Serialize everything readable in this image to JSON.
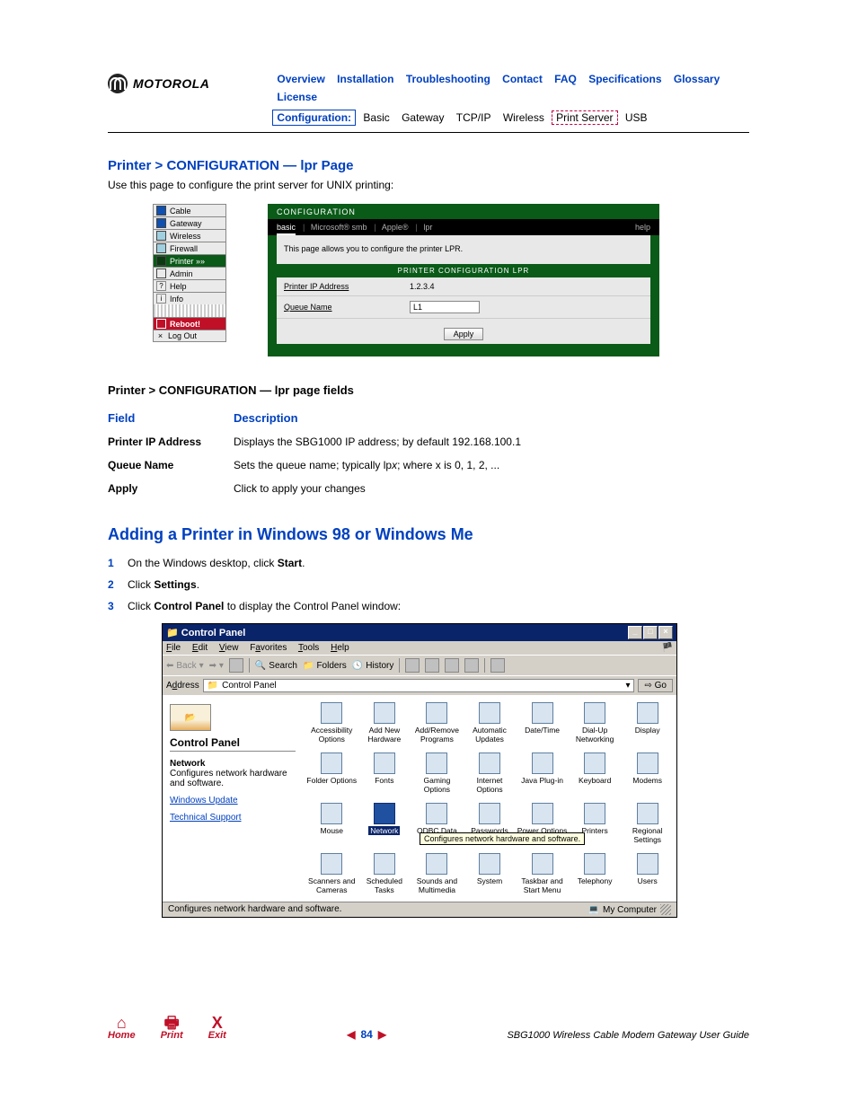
{
  "logo_text": "MOTOROLA",
  "nav": {
    "row1": [
      "Overview",
      "Installation",
      "Troubleshooting",
      "Contact",
      "FAQ",
      "Specifications",
      "Glossary",
      "License"
    ],
    "current": "Configuration:",
    "row2": [
      "Basic",
      "Gateway",
      "TCP/IP",
      "Wireless"
    ],
    "print_server": "Print Server",
    "row2_after": "USB"
  },
  "section_title": "Printer > CONFIGURATION — lpr Page",
  "intro": "Use this page to configure the print server for UNIX printing:",
  "sidebar_items": [
    {
      "label": "Cable",
      "sq": "sb-blue"
    },
    {
      "label": "Gateway",
      "sq": "sb-blue"
    },
    {
      "label": "Wireless",
      "sq": "sb-cyan"
    },
    {
      "label": "Firewall",
      "sq": "sb-cyan"
    },
    {
      "label": "Printer   »»",
      "sq": "",
      "cls": "sb-printer"
    },
    {
      "label": "Admin",
      "sq": ""
    },
    {
      "label": "Help",
      "sq": "",
      "pre": "?"
    },
    {
      "label": "Info",
      "sq": "",
      "pre": "i"
    }
  ],
  "sb_reboot": "Reboot!",
  "sb_logout": "Log Out",
  "cp": {
    "title": "CONFIGURATION",
    "tabs": [
      "basic",
      "Microsoft® smb",
      "Apple®",
      "lpr"
    ],
    "help": "help",
    "hint": "This page allows you to configure the printer LPR.",
    "barhead": "PRINTER CONFIGURATION LPR",
    "row1_label": "Printer IP Address",
    "row1_value": "1.2.3.4",
    "row2_label": "Queue Name",
    "row2_value": "L1",
    "apply": "Apply"
  },
  "fields_title": "Printer > CONFIGURATION — lpr page fields",
  "fields_head_field": "Field",
  "fields_head_desc": "Description",
  "fields": [
    {
      "f": "Printer IP Address",
      "d": "Displays the SBG1000 IP address; by default 192.168.100.1"
    },
    {
      "f": "Queue Name",
      "d": "Sets the queue name; typically lpx; where x is 0, 1, 2, ..."
    },
    {
      "f": "Apply",
      "d": "Click to apply your changes"
    }
  ],
  "h2": "Adding a Printer in Windows 98 or Windows Me",
  "steps": [
    {
      "n": "1",
      "pre": "On the Windows desktop, click ",
      "bold": "Start",
      "post": "."
    },
    {
      "n": "2",
      "pre": "Click ",
      "bold": "Settings",
      "post": "."
    },
    {
      "n": "3",
      "pre": "Click ",
      "bold": "Control Panel",
      "post": " to display the Control Panel window:"
    }
  ],
  "cpw": {
    "title": "Control Panel",
    "menu": [
      "File",
      "Edit",
      "View",
      "Favorites",
      "Tools",
      "Help"
    ],
    "toolbar_back": "Back",
    "toolbar_search": "Search",
    "toolbar_folders": "Folders",
    "toolbar_history": "History",
    "addr_label": "Address",
    "addr_value": "Control Panel",
    "go": "Go",
    "side_title": "Control Panel",
    "side_bold": "Network",
    "side_desc": "Configures network hardware and software.",
    "side_link1": "Windows Update",
    "side_link2": "Technical Support",
    "icons": [
      "Accessibility Options",
      "Add New Hardware",
      "Add/Remove Programs",
      "Automatic Updates",
      "Date/Time",
      "Dial-Up Networking",
      "Display",
      "Folder Options",
      "Fonts",
      "Gaming Options",
      "Internet Options",
      "Java Plug-in",
      "Keyboard",
      "Modems",
      "Mouse",
      "Network",
      "ODBC Data",
      "Passwords",
      "Power Options",
      "Printers",
      "Regional Settings",
      "Scanners and Cameras",
      "Scheduled Tasks",
      "Sounds and Multimedia",
      "System",
      "Taskbar and Start Menu",
      "Telephony",
      "Users"
    ],
    "tooltip": "Configures network hardware and software.",
    "status_left": "Configures network hardware and software.",
    "status_right": "My Computer"
  },
  "footer": {
    "home": "Home",
    "print": "Print",
    "exit": "Exit",
    "page": "84",
    "guide": "SBG1000 Wireless Cable Modem Gateway User Guide"
  }
}
